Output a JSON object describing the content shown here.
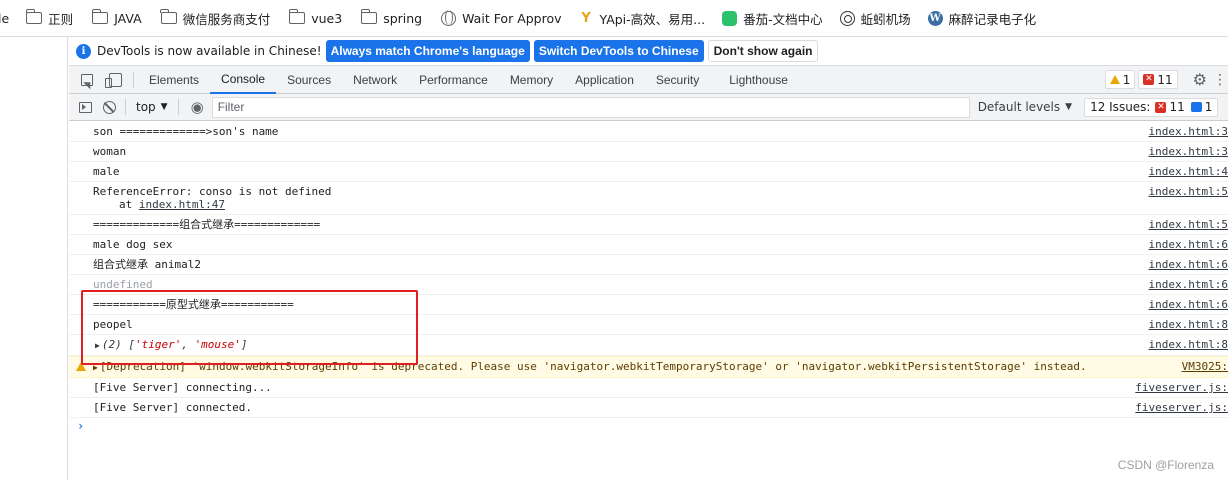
{
  "bookmarks": [
    {
      "label": "le",
      "icon": "none"
    },
    {
      "label": "正则",
      "icon": "folder-icon"
    },
    {
      "label": "JAVA",
      "icon": "folder-icon"
    },
    {
      "label": "微信服务商支付",
      "icon": "folder-icon"
    },
    {
      "label": "vue3",
      "icon": "folder-icon"
    },
    {
      "label": "spring",
      "icon": "folder-icon"
    },
    {
      "label": "Wait For Approv",
      "icon": "globe-icon"
    },
    {
      "label": "YApi-高效、易用...",
      "icon": "yapi-icon"
    },
    {
      "label": "番茄-文档中心",
      "icon": "tomato-icon"
    },
    {
      "label": "蚯蚓机场",
      "icon": "earthworm-icon"
    },
    {
      "label": "麻醉记录电子化",
      "icon": "wordpress-icon"
    }
  ],
  "infobar": {
    "text": "DevTools is now available in Chinese!",
    "btn_match": "Always match Chrome's language",
    "btn_switch": "Switch DevTools to Chinese",
    "btn_dismiss": "Don't show again"
  },
  "tabs": [
    "Elements",
    "Console",
    "Sources",
    "Network",
    "Performance",
    "Memory",
    "Application",
    "Security",
    "Lighthouse"
  ],
  "active_tab": "Console",
  "counters": {
    "warnings": "1",
    "errors": "11"
  },
  "toolbar": {
    "context": "top",
    "filter_placeholder": "Filter",
    "levels": "Default levels",
    "issues_label": "12 Issues:",
    "issues_errors": "11",
    "issues_info": "1"
  },
  "console": {
    "rows": [
      {
        "text": "son =============>son's name",
        "src": "index.html:3"
      },
      {
        "text": "woman",
        "src": "index.html:3"
      },
      {
        "text": "male",
        "src": "index.html:4"
      },
      {
        "text": "ReferenceError: conso is not defined",
        "sub_prefix": "at ",
        "sub_link": "index.html:47",
        "src": "index.html:5"
      },
      {
        "text": "=============组合式继承=============",
        "src": "index.html:5"
      },
      {
        "text": "male dog sex",
        "src": "index.html:6"
      },
      {
        "text": "组合式继承 animal2",
        "src": "index.html:6"
      },
      {
        "text": "undefined",
        "src": "index.html:6"
      },
      {
        "text": "===========原型式继承===========",
        "src": "index.html:6"
      },
      {
        "text": "peopel",
        "src": "index.html:8"
      },
      {
        "array_prefix": "(2) [",
        "array_a": "'tiger'",
        "array_sep": ", ",
        "array_b": "'mouse'",
        "array_suffix": "]",
        "src": "index.html:8"
      },
      {
        "text": "[Deprecation] 'window.webkitStorageInfo' is deprecated. Please use 'navigator.webkitTemporaryStorage' or 'navigator.webkitPersistentStorage' instead.",
        "src": "VM3025:"
      },
      {
        "text": "[Five Server] connecting...",
        "src": "fiveserver.js:"
      },
      {
        "text": "[Five Server] connected.",
        "src": "fiveserver.js:"
      }
    ],
    "prompt": "›"
  },
  "watermark": "CSDN @Florenza",
  "colors": {
    "accent": "#1a73e8",
    "error": "#d93025",
    "warning": "#e8a600",
    "highlight": "#e02020"
  }
}
